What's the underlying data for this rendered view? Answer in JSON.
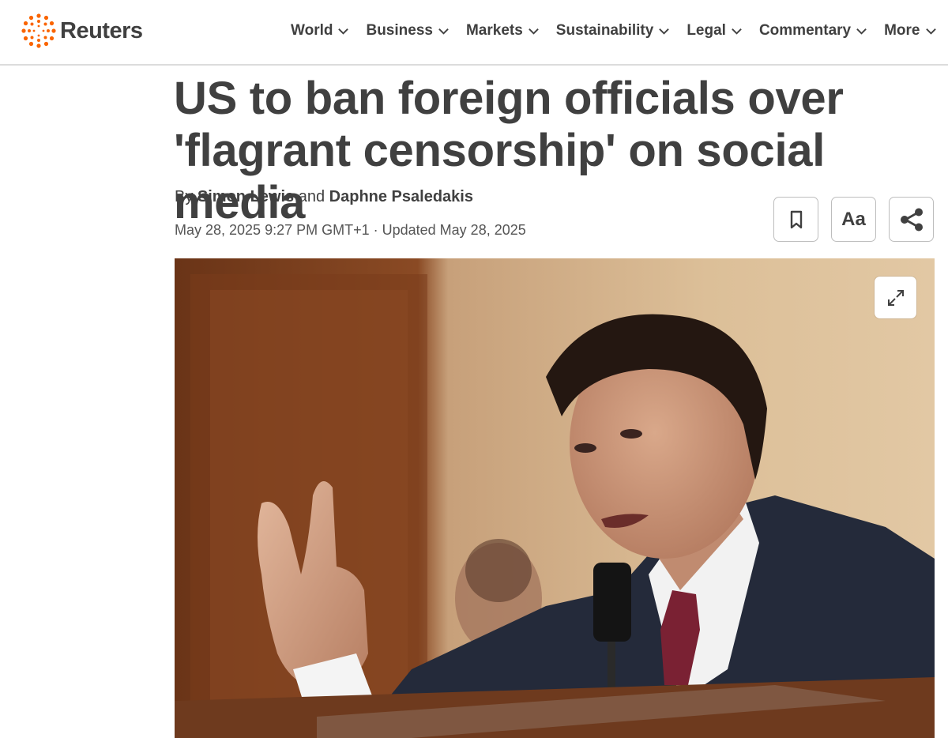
{
  "brand": {
    "name": "Reuters",
    "logo_icon": "reuters-dots-logo",
    "accent": "#fa6400"
  },
  "nav": {
    "items": [
      {
        "label": "World"
      },
      {
        "label": "Business"
      },
      {
        "label": "Markets"
      },
      {
        "label": "Sustainability"
      },
      {
        "label": "Legal"
      },
      {
        "label": "Commentary"
      },
      {
        "label": "More"
      }
    ]
  },
  "article": {
    "headline": "US to ban foreign officials over 'flagrant censorship' on social media",
    "byline_prefix": "By",
    "authors": [
      "Simon Lewis",
      "Daphne Psaledakis"
    ],
    "byline_joiner": "and",
    "timestamp": "May 28, 2025 9:27 PM GMT+1 · Updated May 28, 2025",
    "text_size_label": "Aa"
  },
  "toolbar": {
    "bookmark_icon": "bookmark-icon",
    "text_size_icon": "text-size-icon",
    "share_icon": "share-icon"
  },
  "photo": {
    "expand_icon": "expand-icon"
  }
}
